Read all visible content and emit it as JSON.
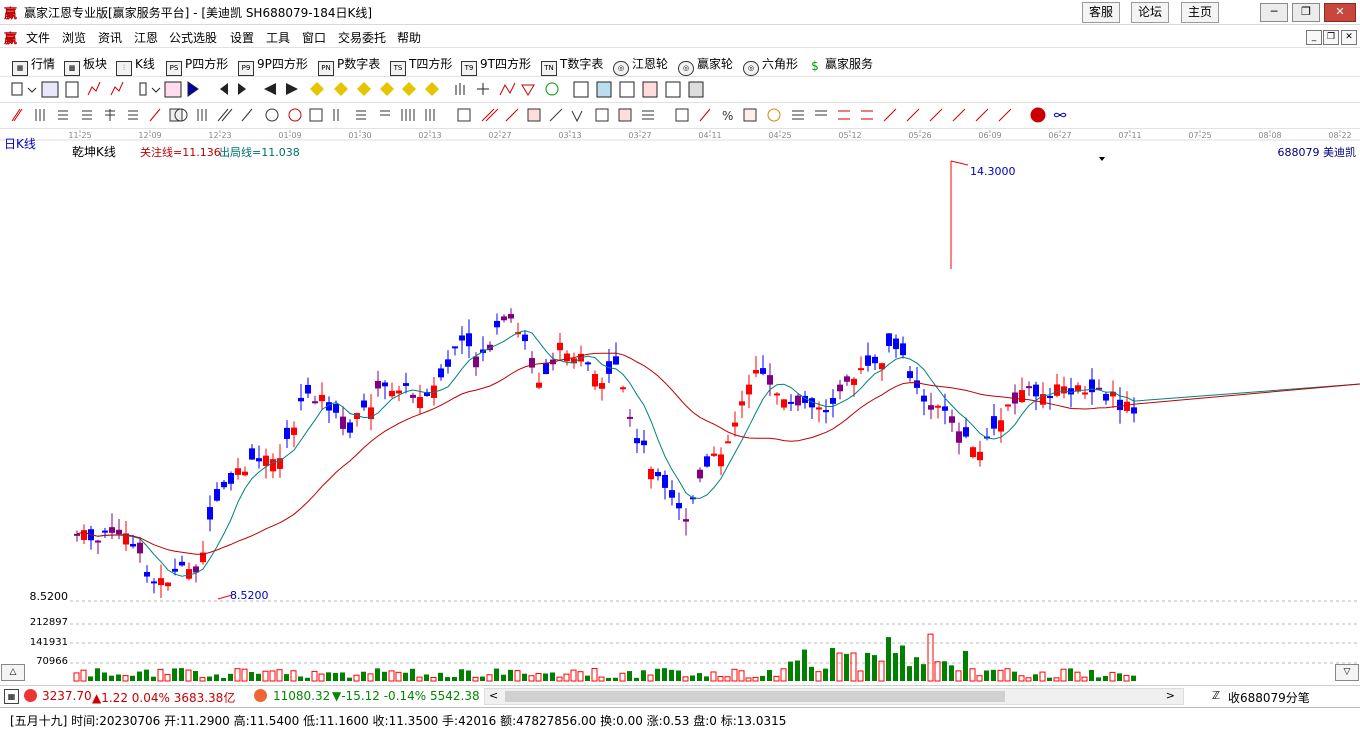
{
  "window": {
    "logo": "赢",
    "title": "赢家江恩专业版[赢家服务平台] - [美迪凯  SH688079-184日K线]",
    "links": [
      "客服",
      "论坛",
      "主页"
    ],
    "controls": {
      "minimize": "─",
      "restore": "❐",
      "close": "✕"
    }
  },
  "menubar": {
    "logo": "赢",
    "items": [
      "文件",
      "浏览",
      "资讯",
      "江恩",
      "公式选股",
      "设置",
      "工具",
      "窗口",
      "交易委托",
      "帮助"
    ],
    "mdi": [
      "_",
      "❐",
      "✕"
    ]
  },
  "toolbar1": {
    "items": [
      {
        "icon": "quote-table-icon",
        "glyph": "▦",
        "label": "行情"
      },
      {
        "icon": "sector-grid-icon",
        "glyph": "▩",
        "label": "板块"
      },
      {
        "icon": "kline-icon",
        "glyph": "⫶",
        "label": "K线"
      },
      {
        "icon": "ps-icon",
        "glyph": "PS",
        "label": "P四方形"
      },
      {
        "icon": "p9-icon",
        "glyph": "P9",
        "label": "9P四方形"
      },
      {
        "icon": "pn-icon",
        "glyph": "PN",
        "label": "P数字表"
      },
      {
        "icon": "ts-icon",
        "glyph": "TS",
        "label": "T四方形"
      },
      {
        "icon": "t9-icon",
        "glyph": "T9",
        "label": "9T四方形"
      },
      {
        "icon": "tn-icon",
        "glyph": "TN",
        "label": "T数字表"
      },
      {
        "icon": "gann-wheel-icon",
        "glyph": "◎",
        "label": "江恩轮"
      },
      {
        "icon": "winner-wheel-icon",
        "glyph": "◎",
        "label": "赢家轮"
      },
      {
        "icon": "hexagon-icon",
        "glyph": "◎",
        "label": "六角形"
      },
      {
        "icon": "dollar-icon",
        "glyph": "$",
        "label": "赢家服务"
      }
    ]
  },
  "chart": {
    "period_label": "日K线",
    "indicator_name": "乾坤K线",
    "indicator_a": "关注线=11.136",
    "indicator_b": "出局线=11.038",
    "stock_tag": "688079  美迪凯",
    "high_label": "14.3000",
    "low_label": "8.5200",
    "low_axis_label": "8.5200",
    "volume_labels": [
      "212897",
      "141931",
      "70966"
    ],
    "date_ticks": [
      "11-25",
      "12-09",
      "12-23",
      "01-09",
      "01-30",
      "02-13",
      "02-27",
      "03-13",
      "03-27",
      "04-11",
      "04-25",
      "05-12",
      "05-26",
      "06-09",
      "06-27",
      "07-11",
      "07-25",
      "08-08",
      "08-22"
    ],
    "colors": {
      "up": "#ff0000",
      "down": "#0000ff",
      "neutral": "#800080",
      "ma_short": "#008080",
      "ma_long": "#c00000",
      "vol_up": "#ff0000",
      "vol_down": "#008000"
    }
  },
  "indexbar": {
    "sh_value": "3237.70",
    "sh_change": "▲1.22 0.04% 3683.38亿",
    "sz_value": "11080.32",
    "sz_change": "▼-15.12 -0.14% 5542.38",
    "collect": "收688079分笔"
  },
  "statusbar": {
    "text": "[五月十九] 时间:20230706 开:11.2900 高:11.5400 低:11.1600 收:11.3500 手:42016 额:47827856.00 换:0.00 涨:0.53 盘:0 标:13.0315"
  }
}
